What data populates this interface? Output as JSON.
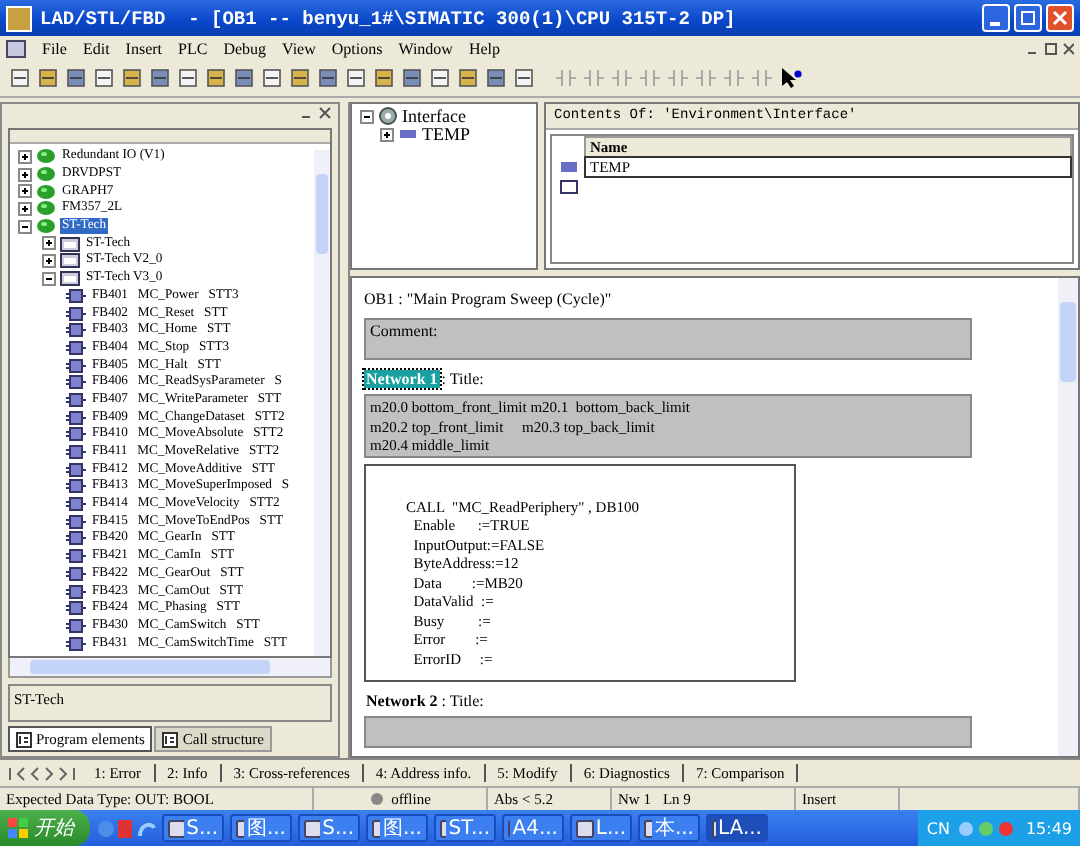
{
  "window": {
    "title": "LAD/STL/FBD  - [OB1 -- benyu_1#\\SIMATIC 300(1)\\CPU 315T-2 DP]"
  },
  "menu": [
    "File",
    "Edit",
    "Insert",
    "PLC",
    "Debug",
    "View",
    "Options",
    "Window",
    "Help"
  ],
  "tree": [
    {
      "label": "Redundant IO (V1)",
      "expanded": false,
      "selected": false
    },
    {
      "label": "DRVDPST",
      "expanded": false,
      "selected": false
    },
    {
      "label": "GRAPH7",
      "expanded": false,
      "selected": false
    },
    {
      "label": "FM357_2L",
      "expanded": false,
      "selected": false
    },
    {
      "label": "ST-Tech",
      "expanded": true,
      "selected": true,
      "children": [
        {
          "label": "ST-Tech",
          "expanded": false,
          "selected": false
        },
        {
          "label": "ST-Tech V2_0",
          "expanded": false,
          "selected": false
        },
        {
          "label": "ST-Tech V3_0",
          "expanded": true,
          "selected": false,
          "children": [
            {
              "label": "FB401   MC_Power   STT3",
              "selected": false
            },
            {
              "label": "FB402   MC_Reset   STT",
              "selected": false
            },
            {
              "label": "FB403   MC_Home   STT",
              "selected": false
            },
            {
              "label": "FB404   MC_Stop   STT3",
              "selected": false
            },
            {
              "label": "FB405   MC_Halt   STT",
              "selected": false
            },
            {
              "label": "FB406   MC_ReadSysParameter   S",
              "selected": false
            },
            {
              "label": "FB407   MC_WriteParameter   STT",
              "selected": false
            },
            {
              "label": "FB409   MC_ChangeDataset   STT2",
              "selected": false
            },
            {
              "label": "FB410   MC_MoveAbsolute   STT2",
              "selected": false
            },
            {
              "label": "FB411   MC_MoveRelative   STT2",
              "selected": false
            },
            {
              "label": "FB412   MC_MoveAdditive   STT",
              "selected": false
            },
            {
              "label": "FB413   MC_MoveSuperImposed   S",
              "selected": false
            },
            {
              "label": "FB414   MC_MoveVelocity   STT2",
              "selected": false
            },
            {
              "label": "FB415   MC_MoveToEndPos   STT",
              "selected": false
            },
            {
              "label": "FB420   MC_GearIn   STT",
              "selected": false
            },
            {
              "label": "FB421   MC_CamIn   STT",
              "selected": false
            },
            {
              "label": "FB422   MC_GearOut   STT",
              "selected": false
            },
            {
              "label": "FB423   MC_CamOut   STT",
              "selected": false
            },
            {
              "label": "FB424   MC_Phasing   STT",
              "selected": false
            },
            {
              "label": "FB430   MC_CamSwitch   STT",
              "selected": false
            },
            {
              "label": "FB431   MC_CamSwitchTime   STT",
              "selected": false
            }
          ]
        }
      ]
    }
  ],
  "info_text": "ST-Tech",
  "left_tabs": [
    {
      "label": "Program elements",
      "selected": true
    },
    {
      "label": "Call structure",
      "selected": false
    }
  ],
  "interface_tree": [
    {
      "label": "Interface",
      "expanded": true,
      "children": [
        {
          "label": "TEMP",
          "expanded": false
        }
      ]
    }
  ],
  "contents": {
    "title": "Contents Of: 'Environment\\Interface'",
    "column": "Name",
    "rows": [
      "TEMP"
    ]
  },
  "code": {
    "block_title": "OB1 :  \"Main Program Sweep (Cycle)\"",
    "block_comment": "Comment:",
    "networks": [
      {
        "label": "Network 1",
        "selected": true,
        "title": ": Title:",
        "comment": [
          "m20.0 bottom_front_limit m20.1  bottom_back_limit",
          "m20.2 top_front_limit     m20.3 top_back_limit",
          "m20.4 middle_limit"
        ],
        "code": [
          "CALL  \"MC_ReadPeriphery\" , DB100",
          "  Enable      :=TRUE",
          "  InputOutput:=FALSE",
          "  ByteAddress:=12",
          "  Data        :=MB20",
          "  DataValid  :=",
          "  Busy         :=",
          "  Error        :=",
          "  ErrorID     :="
        ]
      },
      {
        "label": "Network 2",
        "selected": false,
        "title": ": Title:"
      }
    ]
  },
  "bottom_tabs": [
    {
      "label": "1: Error",
      "selected": false
    },
    {
      "label": "2: Info",
      "selected": false
    },
    {
      "label": "3: Cross-references",
      "selected": false
    },
    {
      "label": "4: Address info.",
      "selected": false
    },
    {
      "label": "5: Modify",
      "selected": false
    },
    {
      "label": "6: Diagnostics",
      "selected": false
    },
    {
      "label": "7: Comparison",
      "selected": false
    }
  ],
  "status_bar": {
    "message": "Expected Data Type: OUT: BOOL",
    "mode": "offline",
    "address": "Abs < 5.2",
    "network": "Nw 1",
    "line": "Ln 9",
    "edit_mode": "Insert"
  },
  "taskbar": {
    "start": "开始",
    "items": [
      {
        "label": "S...",
        "selected": false
      },
      {
        "label": "图...",
        "selected": false
      },
      {
        "label": "S...",
        "selected": false
      },
      {
        "label": "图...",
        "selected": false
      },
      {
        "label": "ST...",
        "selected": false
      },
      {
        "label": "A4...",
        "selected": false
      },
      {
        "label": "L...",
        "selected": false
      },
      {
        "label": "本...",
        "selected": false
      },
      {
        "label": "LA...",
        "selected": true
      }
    ],
    "language": "CN",
    "clock": "15:49"
  }
}
